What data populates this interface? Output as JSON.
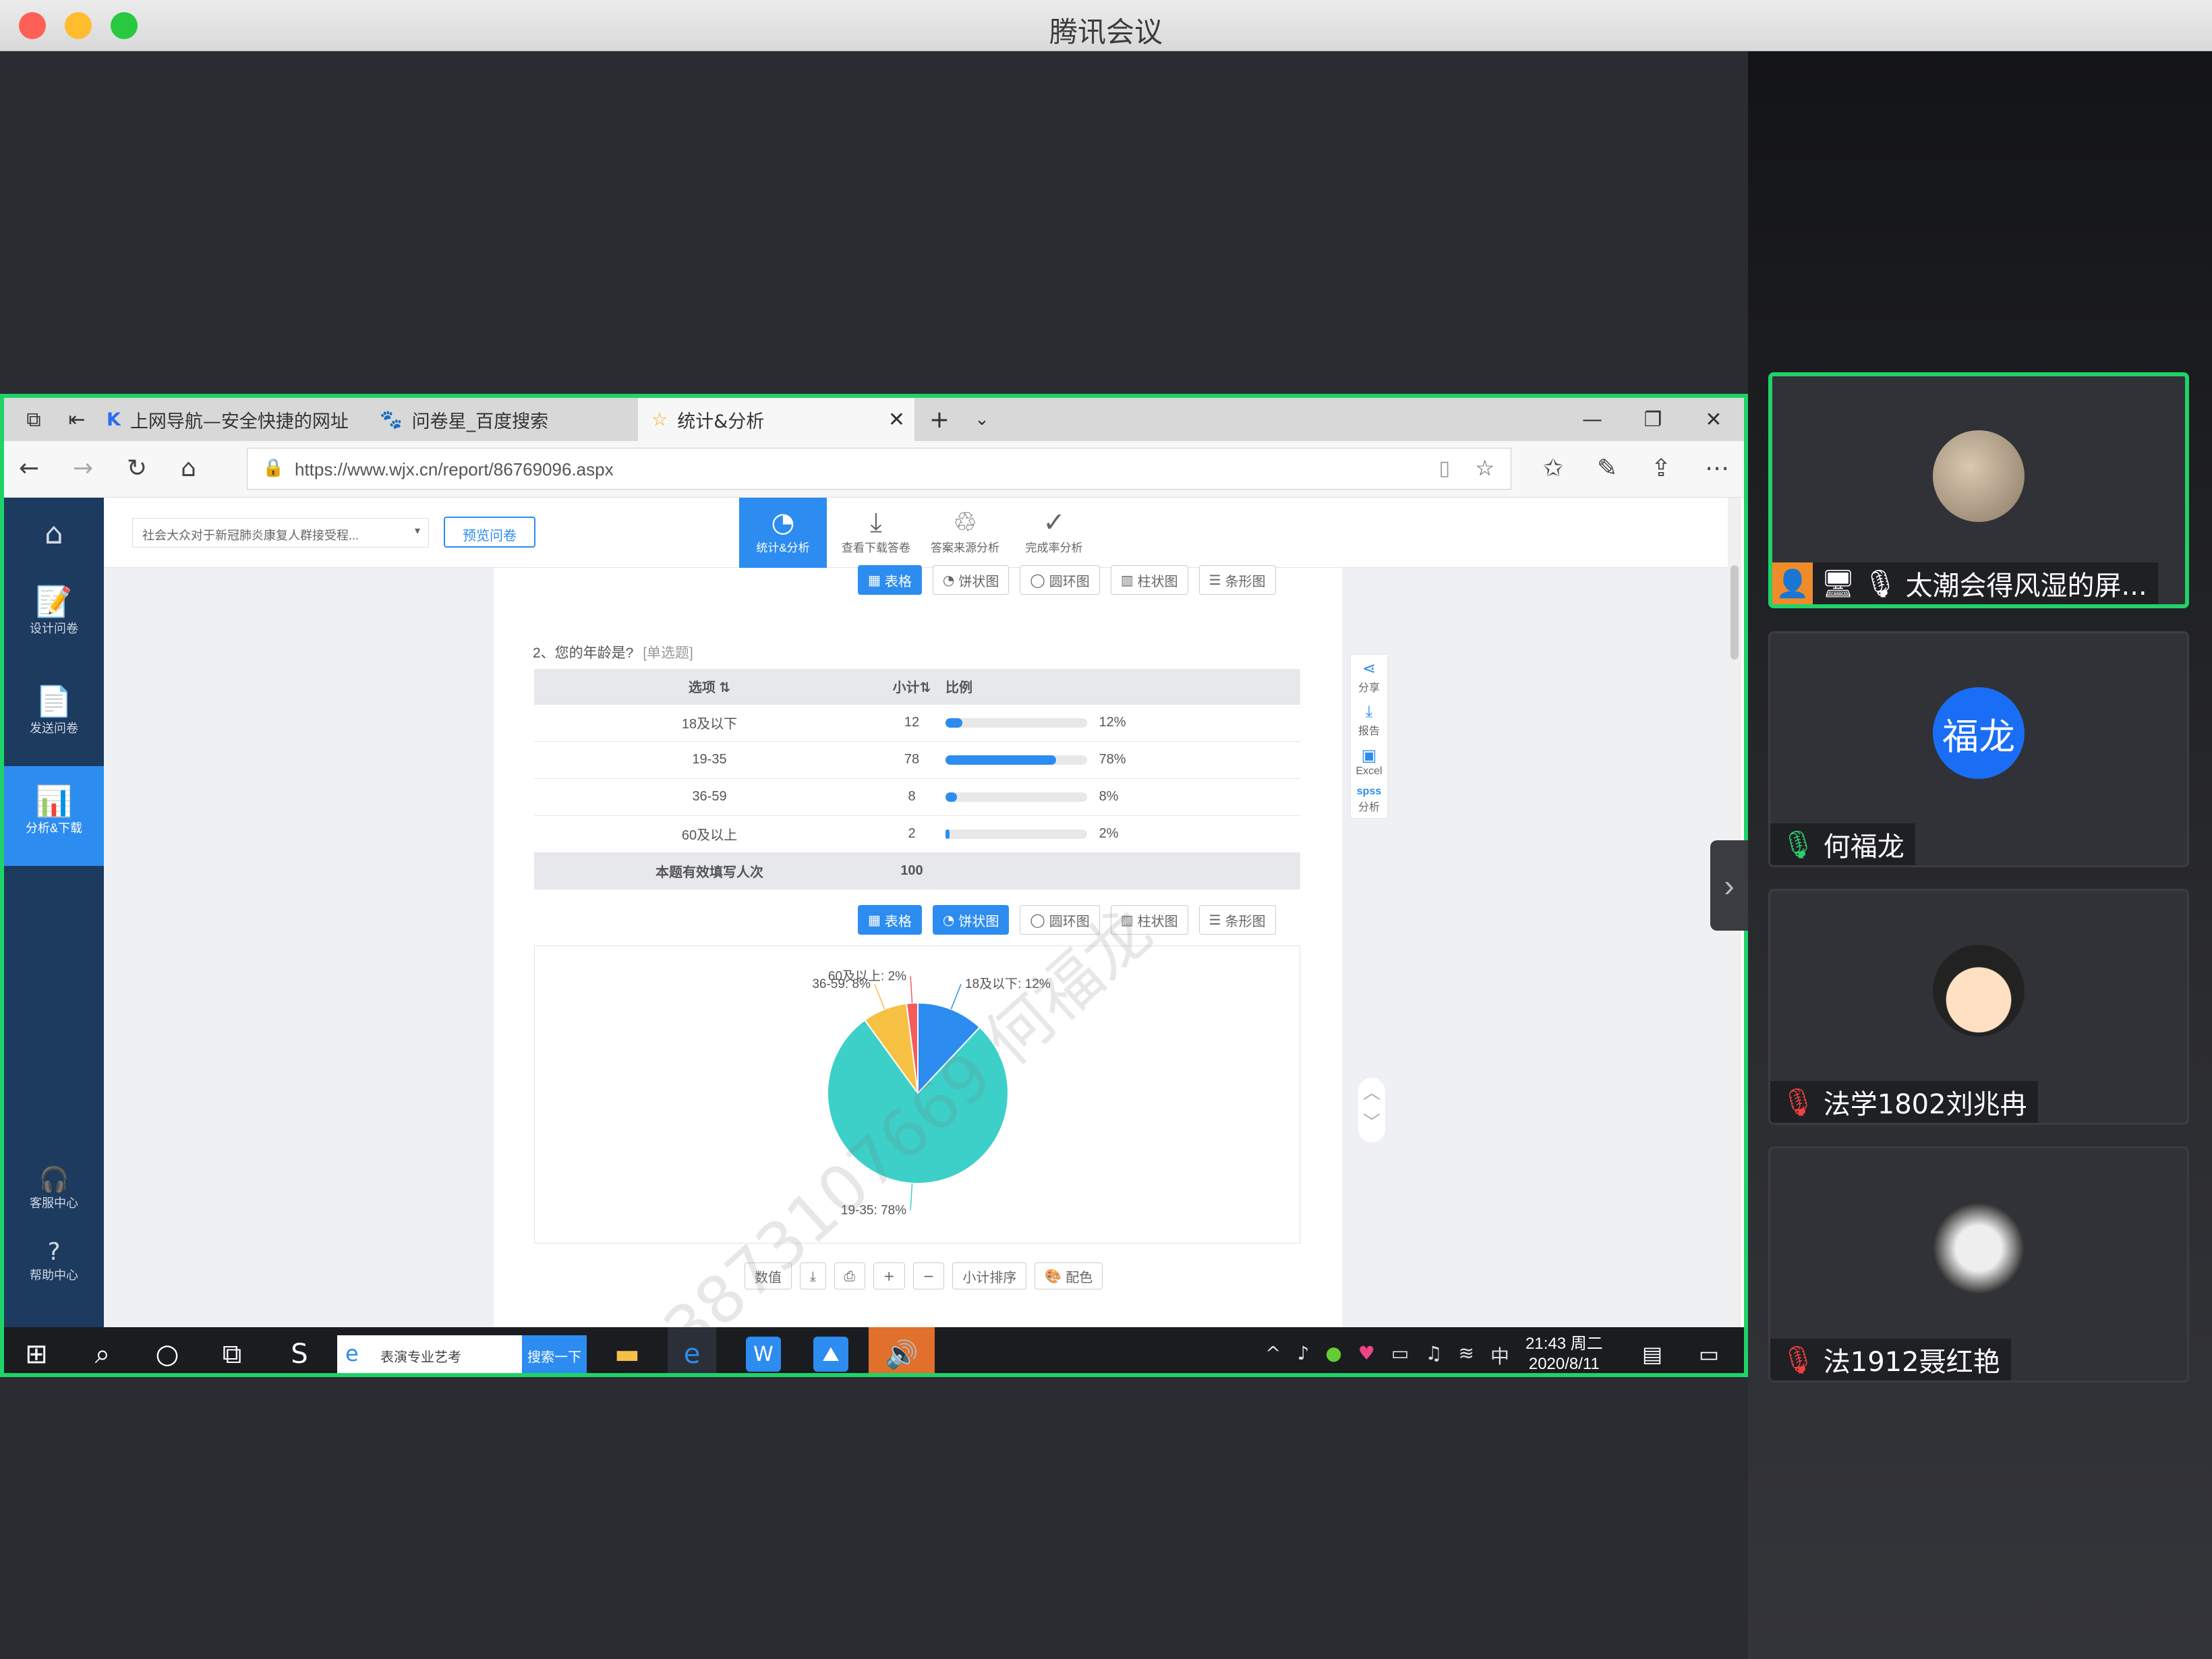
{
  "window": {
    "title": "腾讯会议"
  },
  "browser": {
    "tabs": [
      {
        "label": "上网导航—安全快捷的网址"
      },
      {
        "label": "问卷星_百度搜索"
      },
      {
        "label": "统计&分析"
      }
    ],
    "url": "https://www.wjx.cn/report/86769096.aspx"
  },
  "app": {
    "left_nav": [
      {
        "label": "设计问卷",
        "icon": "edit-icon"
      },
      {
        "label": "发送问卷",
        "icon": "send-icon"
      },
      {
        "label": "分析&下载",
        "icon": "analytics-icon"
      },
      {
        "label": "客服中心",
        "icon": "headset-icon"
      },
      {
        "label": "帮助中心",
        "icon": "help-icon"
      }
    ],
    "survey_select": "社会大众对于新冠肺炎康复人群接受程...",
    "preview_label": "预览问卷",
    "top_tabs": [
      {
        "label": "统计&分析"
      },
      {
        "label": "查看下载答卷"
      },
      {
        "label": "答案来源分析"
      },
      {
        "label": "完成率分析"
      }
    ],
    "view_buttons": [
      "表格",
      "饼状图",
      "圆环图",
      "柱状图",
      "条形图"
    ],
    "question": "2、您的年龄是?",
    "question_type": "[单选题]",
    "table": {
      "headers": [
        "选项",
        "小计",
        "比例"
      ],
      "rows": [
        {
          "option": "18及以下",
          "count": "12",
          "pct": "12%",
          "ratio": 0.12
        },
        {
          "option": "19-35",
          "count": "78",
          "pct": "78%",
          "ratio": 0.78
        },
        {
          "option": "36-59",
          "count": "8",
          "pct": "8%",
          "ratio": 0.08
        },
        {
          "option": "60及以上",
          "count": "2",
          "pct": "2%",
          "ratio": 0.02
        }
      ],
      "total_label": "本题有效填写人次",
      "total": "100"
    },
    "side_tools": [
      "分享",
      "报告",
      "Excel",
      "分析"
    ],
    "chart_tools": [
      "数值",
      "小计排序",
      "配色"
    ],
    "watermark": "+8613873107669 何福龙"
  },
  "chart_data": {
    "type": "pie",
    "categories": [
      "18及以下",
      "19-35",
      "36-59",
      "60及以上"
    ],
    "values": [
      12,
      78,
      8,
      2
    ],
    "labels": [
      "18及以下: 12%",
      "19-35: 78%",
      "36-59: 8%",
      "60及以上: 2%"
    ],
    "colors": [
      "#2d8cf0",
      "#3cd0c9",
      "#f7c144",
      "#f45b5b"
    ]
  },
  "taskbar": {
    "search_text": "表演专业艺考",
    "search_button": "搜索一下",
    "ime": "中",
    "time": "21:43 周二",
    "date": "2020/8/11"
  },
  "participants": [
    {
      "name": "太潮会得风湿的屏...",
      "muted": false,
      "sharing": true
    },
    {
      "name": "何福龙",
      "muted": false,
      "avatar_text": "福龙"
    },
    {
      "name": "法学1802刘兆冉",
      "muted": true
    },
    {
      "name": "法1912聂红艳",
      "muted": true
    }
  ]
}
